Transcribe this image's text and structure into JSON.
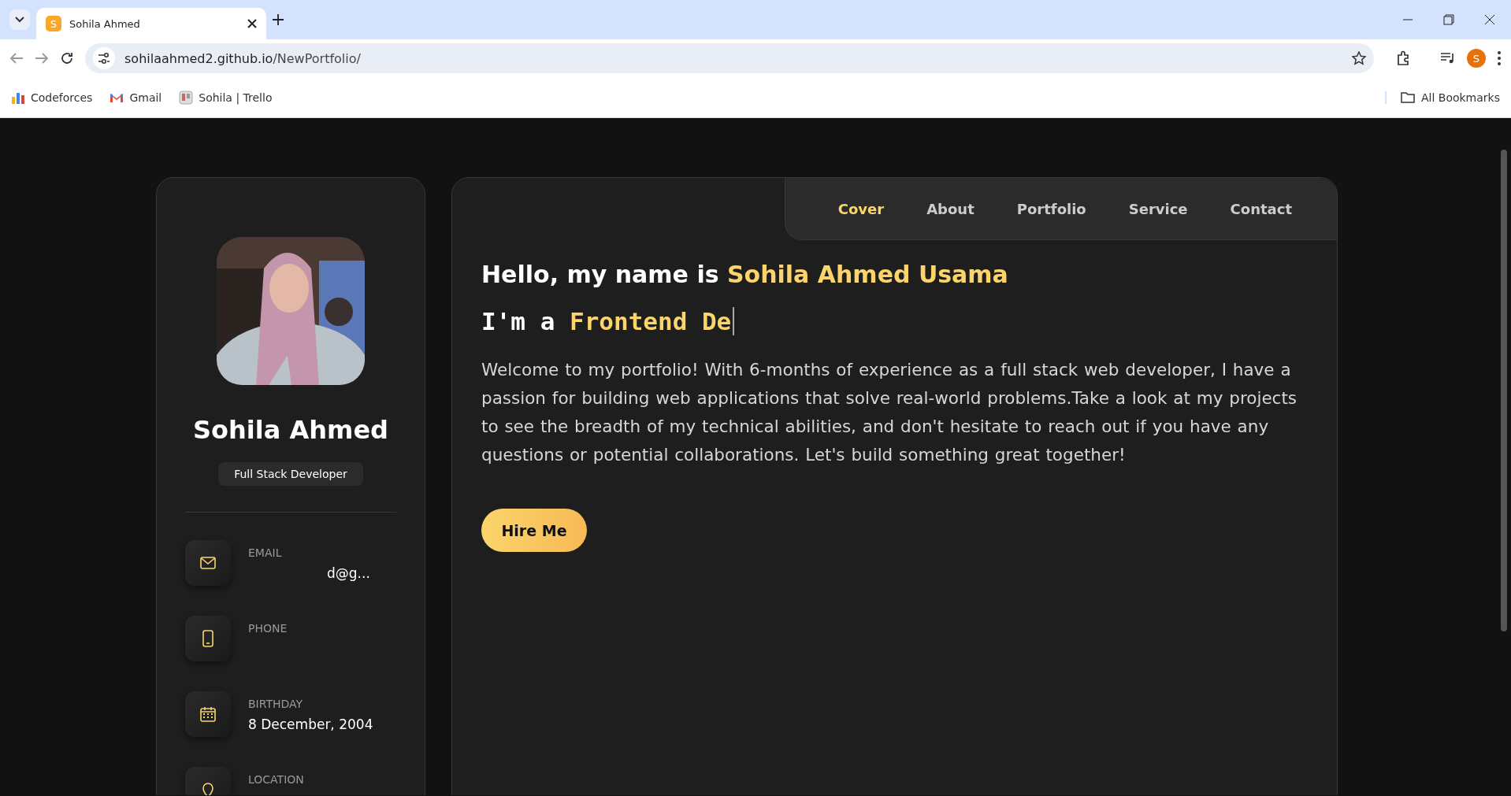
{
  "browser": {
    "tab": {
      "title": "Sohila Ahmed",
      "favicon": "S"
    },
    "url": {
      "host": "sohilaahmed2.github.io",
      "path": "/NewPortfolio/"
    },
    "profile_initial": "S",
    "bookmarks": [
      {
        "label": "Codeforces",
        "kind": "bars"
      },
      {
        "label": "Gmail",
        "kind": "mail"
      },
      {
        "label": "Sohila | Trello",
        "kind": "board"
      }
    ],
    "all_bookmarks": "All Bookmarks"
  },
  "sidebar": {
    "name": "Sohila Ahmed",
    "role": "Full Stack Developer",
    "contacts": [
      {
        "kind": "email",
        "label": "EMAIL",
        "value": "d@g..."
      },
      {
        "kind": "phone",
        "label": "PHONE"
      },
      {
        "kind": "birthday",
        "label": "BIRTHDAY",
        "value": "8 December, 2004"
      },
      {
        "kind": "location",
        "label": "LOCATION"
      }
    ]
  },
  "nav": [
    {
      "label": "Cover",
      "selected": true
    },
    {
      "label": "About",
      "selected": false
    },
    {
      "label": "Portfolio",
      "selected": false
    },
    {
      "label": "Service",
      "selected": false
    },
    {
      "label": "Contact",
      "selected": false
    }
  ],
  "cover": {
    "greeting": "Hello, my name is",
    "full_name": "Sohila Ahmed Usama",
    "typed_prefix": "I'm a",
    "typed_text": "Frontend De",
    "intro": "Welcome to my portfolio! With 6-months of experience as a full stack web developer, I have a passion for building web applications that solve real-world problems.Take a look at my projects to see the breadth of my technical abilities, and don't hesitate to reach out if you have any questions or potential collaborations. Let's build something great together!",
    "button": "Hire Me"
  }
}
